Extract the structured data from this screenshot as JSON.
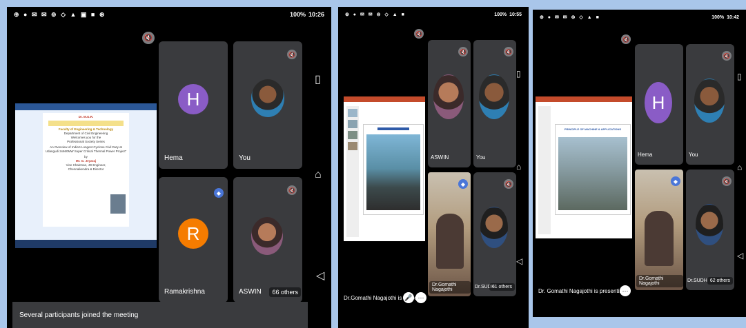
{
  "phone1": {
    "status": {
      "icons": "⊕ ● ✉ ✉ ⊚ ◇ ▲ ▣ ■ ⊛",
      "battery": "100%",
      "time": "10:26"
    },
    "presentation": {
      "college": "Dr. M.G.R.",
      "faculty": "Faculty of Engineering & Technology",
      "department": "Department of Civil Engineering",
      "welcome": "Welcomes you for the",
      "program": "Professional Society Series",
      "topic": "An Overview of India's Longest Cyclone Civil Duty at Udangudi 2x660MW Super Critical Thermal Power Project\"",
      "by": "by",
      "speaker": "Mr. G. Jeyaraj",
      "role": "Vice Chairman, JD Engineer,",
      "role2": "Chennaikendra & Director"
    },
    "tiles": [
      {
        "name": "Hema",
        "initial": "H",
        "color": "#8a5cc6"
      },
      {
        "name": "You"
      },
      {
        "name": "Ramakrishna",
        "initial": "R",
        "color": "#f57c00"
      },
      {
        "name": "ASWIN",
        "others": "66 others"
      }
    ],
    "banner": "Several participants joined the meeting"
  },
  "phone2": {
    "status": {
      "icons": "⊕ ● ✉ ✉ ⊚ ◇ ▲ ■",
      "battery": "100%",
      "time": "10:55"
    },
    "tiles": [
      {
        "name": "ASWIN"
      },
      {
        "name": "You"
      },
      {
        "name": "Dr.Gomathi Nagajothi"
      },
      {
        "name": "Dr.SUDH",
        "others": "61 others"
      }
    ],
    "caption": "Dr.Gomathi Nagajothi is presen..."
  },
  "phone3": {
    "status": {
      "icons": "⊕ ● ✉ ✉ ⊚ ◇ ▲ ■",
      "battery": "100%",
      "time": "10:42"
    },
    "tiles": [
      {
        "name": "Hema",
        "initial": "H",
        "color": "#8a5cc6"
      },
      {
        "name": "You"
      },
      {
        "name": "Dr.Gomathi Nagajothi"
      },
      {
        "name": "Dr.SUDH",
        "others": "62 others"
      }
    ],
    "slide_title": "PRINCIPLE OF MACHINE & APPLICATIONS",
    "caption": "Dr. Gomathi Nagajothi is presenting"
  }
}
